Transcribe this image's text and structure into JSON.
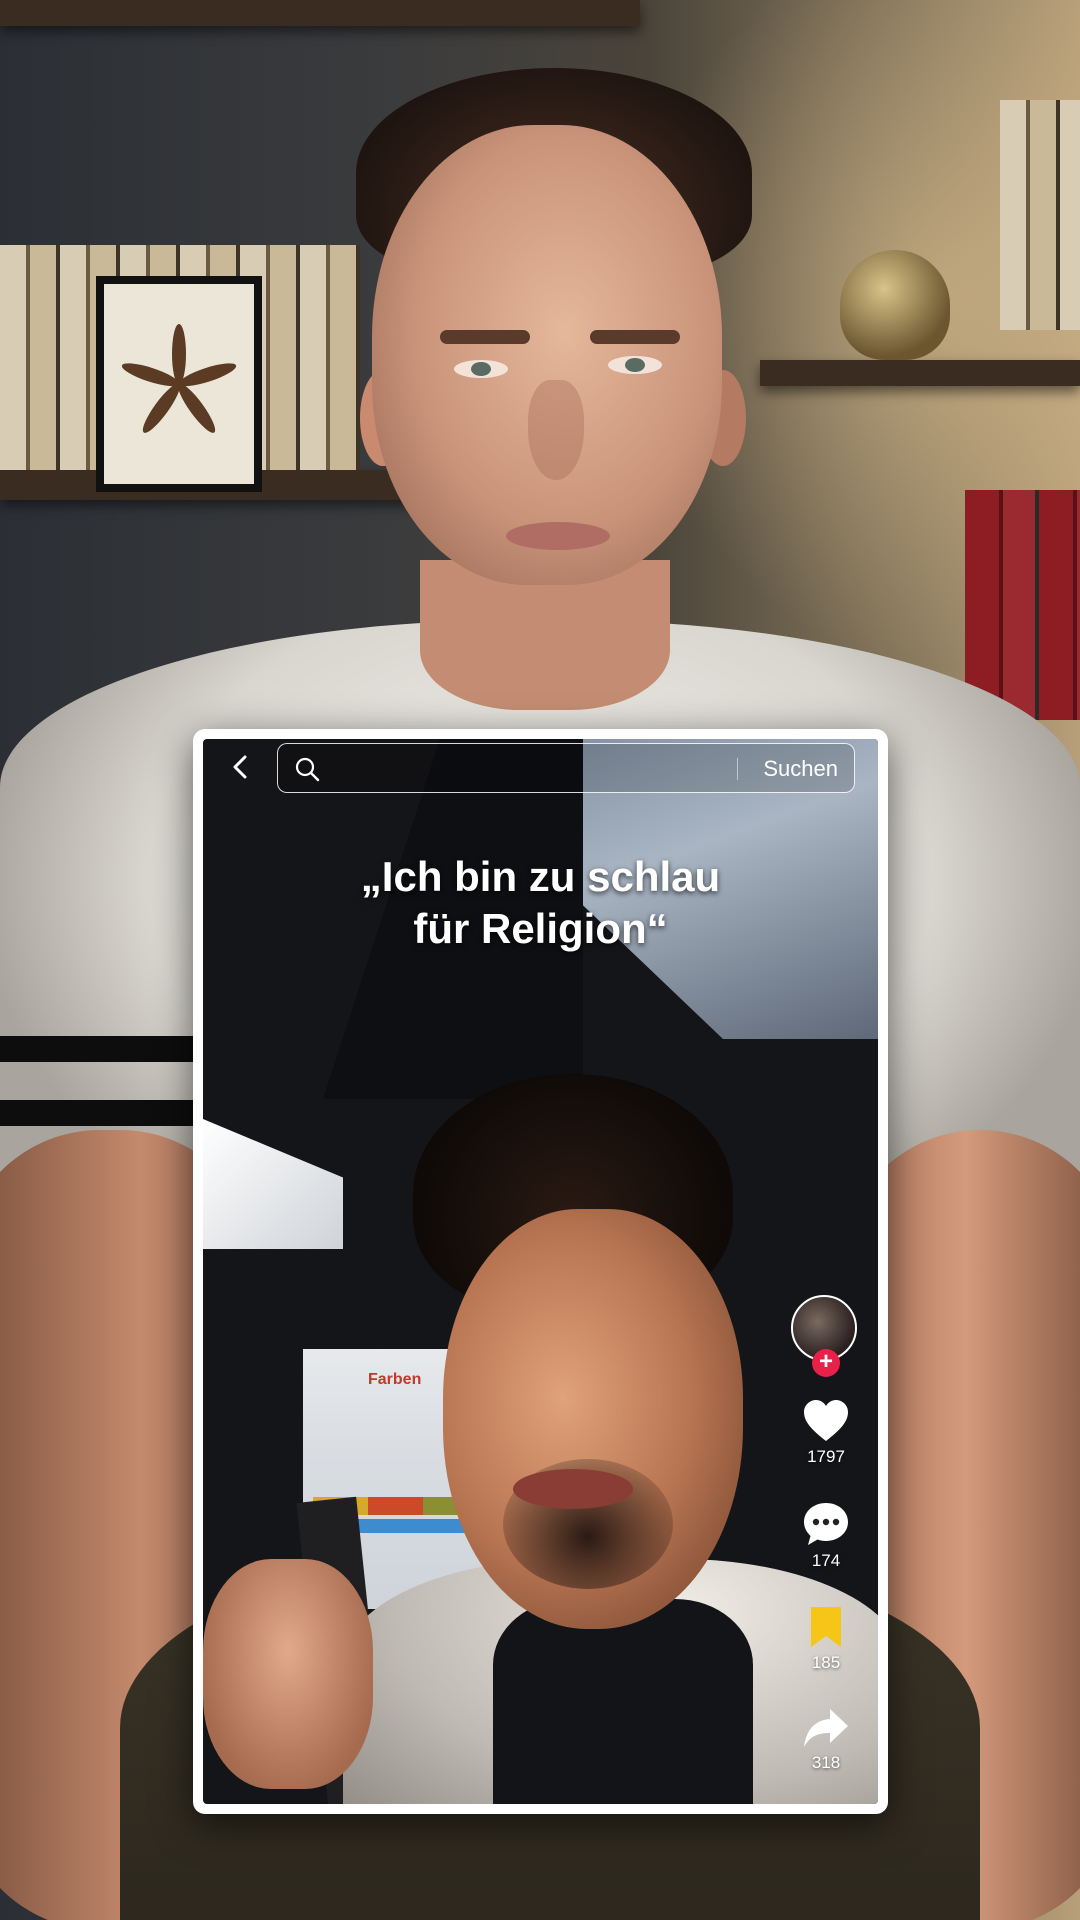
{
  "topbar": {
    "back_icon": "chevron-left-icon",
    "search_icon": "search-icon",
    "search_placeholder": "",
    "search_button_label": "Suchen"
  },
  "caption": {
    "line1": "„Ich bin zu schlau",
    "line2": "für Religion“"
  },
  "storefront_sign": "Farben",
  "actions": {
    "like": {
      "icon": "heart-icon",
      "count": "1797"
    },
    "comment": {
      "icon": "comment-icon",
      "count": "174"
    },
    "bookmark": {
      "icon": "bookmark-icon",
      "count": "185",
      "color": "#f5c518"
    },
    "share": {
      "icon": "share-arrow-icon",
      "count": "318"
    }
  },
  "follow_button_label": "+",
  "colors": {
    "follow_accent": "#e8214a",
    "bookmark_active": "#f5c518"
  }
}
